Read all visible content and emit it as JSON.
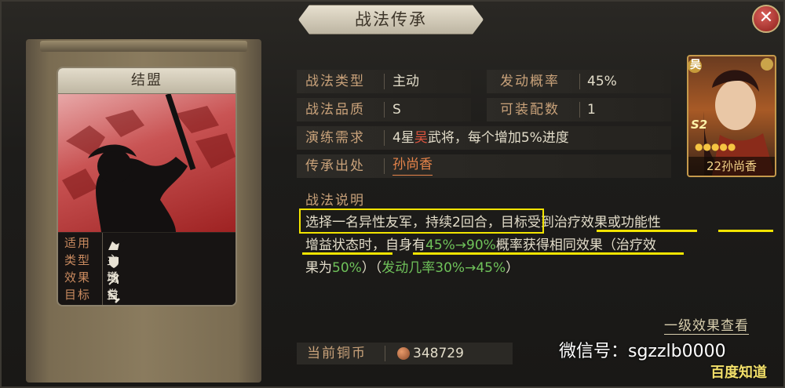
{
  "window": {
    "title": "战法传承"
  },
  "card": {
    "name": "结盟",
    "info": [
      {
        "key": "适用",
        "value": ""
      },
      {
        "key": "类型",
        "value": "主动"
      },
      {
        "key": "效果",
        "value": "增益"
      },
      {
        "key": "目标",
        "value": "自己"
      }
    ],
    "applicable_icons": [
      "cavalry-icon",
      "shield-icon",
      "bow-icon",
      "spear-icon",
      "wheel-icon"
    ]
  },
  "attributes": {
    "tactic_type": {
      "label": "战法类型",
      "value": "主动"
    },
    "trigger_rate": {
      "label": "发动概率",
      "value": "45%"
    },
    "quality": {
      "label": "战法品质",
      "value": "S"
    },
    "equip_count": {
      "label": "可装配数",
      "value": "1"
    },
    "practice": {
      "label": "演练需求",
      "value_a": "4星",
      "value_b": "吴",
      "value_c": "武将，每个增加5%进度"
    },
    "source": {
      "label": "传承出处",
      "value": "孙尚香"
    }
  },
  "portrait": {
    "faction": "吴",
    "rank": "S2",
    "name": "22孙尚香"
  },
  "description": {
    "title": "战法说明",
    "line1_a": "选择一名异性友军，持续2回合",
    "line1_b": "，目标",
    "line1_c": "受到治疗效果",
    "line1_d": "或",
    "line1_e": "功能性",
    "line2_a": "增益状态时",
    "line2_b": "，自身有",
    "line2_c": "45%→90%",
    "line2_d": "概率获得相同效果",
    "line2_e": "（治疗效",
    "line3_a": "果为",
    "line3_b": "50%",
    "line3_c": "）（",
    "line3_d": "发动几率30%→45%",
    "line3_e": "）"
  },
  "footer": {
    "link": "一级效果查看",
    "coin_label": "当前铜币",
    "coin_value": "348729"
  },
  "watermark": {
    "text": "微信号：sgzzlb0000",
    "corner": "百度知道"
  },
  "colors": {
    "highlight": "#f2e400",
    "accent_orange": "#e7844a",
    "green": "#6fc25a",
    "red": "#e0553f"
  }
}
